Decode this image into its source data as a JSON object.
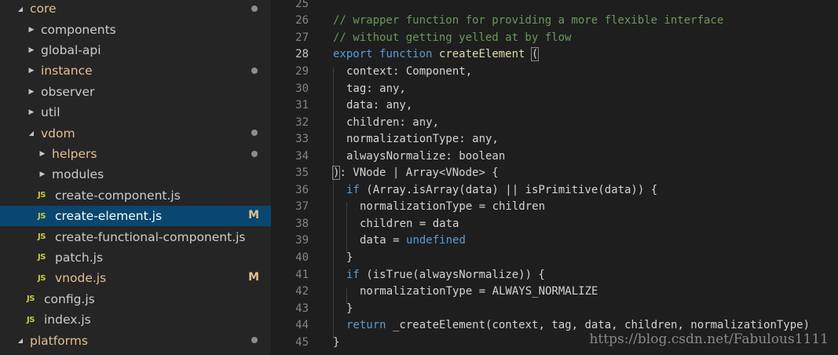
{
  "sidebar": {
    "items": [
      {
        "label": "core",
        "indent": 0,
        "kind": "folder-open",
        "modified": true,
        "marker": "dot",
        "selected": false
      },
      {
        "label": "components",
        "indent": 1,
        "kind": "folder",
        "modified": false,
        "marker": "",
        "selected": false
      },
      {
        "label": "global-api",
        "indent": 1,
        "kind": "folder",
        "modified": false,
        "marker": "",
        "selected": false
      },
      {
        "label": "instance",
        "indent": 1,
        "kind": "folder",
        "modified": true,
        "marker": "dot",
        "selected": false
      },
      {
        "label": "observer",
        "indent": 1,
        "kind": "folder",
        "modified": false,
        "marker": "",
        "selected": false
      },
      {
        "label": "util",
        "indent": 1,
        "kind": "folder",
        "modified": false,
        "marker": "",
        "selected": false
      },
      {
        "label": "vdom",
        "indent": 1,
        "kind": "folder-open",
        "modified": true,
        "marker": "dot",
        "selected": false
      },
      {
        "label": "helpers",
        "indent": 2,
        "kind": "folder",
        "modified": true,
        "marker": "dot",
        "selected": false
      },
      {
        "label": "modules",
        "indent": 2,
        "kind": "folder",
        "modified": false,
        "marker": "",
        "selected": false
      },
      {
        "label": "create-component.js",
        "indent": 2,
        "kind": "js",
        "modified": false,
        "marker": "",
        "selected": false
      },
      {
        "label": "create-element.js",
        "indent": 2,
        "kind": "js",
        "modified": true,
        "marker": "M",
        "selected": true
      },
      {
        "label": "create-functional-component.js",
        "indent": 2,
        "kind": "js",
        "modified": false,
        "marker": "",
        "selected": false
      },
      {
        "label": "patch.js",
        "indent": 2,
        "kind": "js",
        "modified": false,
        "marker": "",
        "selected": false
      },
      {
        "label": "vnode.js",
        "indent": 2,
        "kind": "js",
        "modified": true,
        "marker": "M",
        "selected": false
      },
      {
        "label": "config.js",
        "indent": 1,
        "kind": "js",
        "modified": false,
        "marker": "",
        "selected": false
      },
      {
        "label": "index.js",
        "indent": 1,
        "kind": "js",
        "modified": false,
        "marker": "",
        "selected": false
      },
      {
        "label": "platforms",
        "indent": 0,
        "kind": "folder-open",
        "modified": true,
        "marker": "dot",
        "selected": false
      }
    ],
    "js_icon_text": "JS"
  },
  "editor": {
    "active_line": "28",
    "lines": [
      {
        "n": "25",
        "indent": 0,
        "tokens": []
      },
      {
        "n": "26",
        "indent": 0,
        "tokens": [
          {
            "t": "// wrapper function for providing a more flexible interface",
            "c": "comment"
          }
        ]
      },
      {
        "n": "27",
        "indent": 0,
        "tokens": [
          {
            "t": "// without getting yelled at by flow",
            "c": "comment"
          }
        ]
      },
      {
        "n": "28",
        "indent": 0,
        "tokens": [
          {
            "t": "export",
            "c": "keyword"
          },
          {
            "t": " ",
            "c": "text"
          },
          {
            "t": "function",
            "c": "keyword"
          },
          {
            "t": " ",
            "c": "text"
          },
          {
            "t": "createElement",
            "c": "func"
          },
          {
            "t": " ",
            "c": "text"
          },
          {
            "t": "(",
            "c": "text",
            "box": true
          }
        ]
      },
      {
        "n": "29",
        "indent": 1,
        "tokens": [
          {
            "t": "context: Component,",
            "c": "text"
          }
        ]
      },
      {
        "n": "30",
        "indent": 1,
        "tokens": [
          {
            "t": "tag: any,",
            "c": "text"
          }
        ]
      },
      {
        "n": "31",
        "indent": 1,
        "tokens": [
          {
            "t": "data: any,",
            "c": "text"
          }
        ]
      },
      {
        "n": "32",
        "indent": 1,
        "tokens": [
          {
            "t": "children: any,",
            "c": "text"
          }
        ]
      },
      {
        "n": "33",
        "indent": 1,
        "tokens": [
          {
            "t": "normalizationType: any,",
            "c": "text"
          }
        ]
      },
      {
        "n": "34",
        "indent": 1,
        "tokens": [
          {
            "t": "alwaysNormalize: boolean",
            "c": "text"
          }
        ]
      },
      {
        "n": "35",
        "indent": 0,
        "tokens": [
          {
            "t": ")",
            "c": "text",
            "box": true
          },
          {
            "t": ": VNode | Array<VNode> {",
            "c": "text"
          }
        ]
      },
      {
        "n": "36",
        "indent": 1,
        "tokens": [
          {
            "t": "if",
            "c": "keyword"
          },
          {
            "t": " (Array.isArray(data) || isPrimitive(data)) {",
            "c": "text"
          }
        ]
      },
      {
        "n": "37",
        "indent": 2,
        "tokens": [
          {
            "t": "normalizationType = children",
            "c": "text"
          }
        ]
      },
      {
        "n": "38",
        "indent": 2,
        "tokens": [
          {
            "t": "children = data",
            "c": "text"
          }
        ]
      },
      {
        "n": "39",
        "indent": 2,
        "tokens": [
          {
            "t": "data = ",
            "c": "text"
          },
          {
            "t": "undefined",
            "c": "keyword"
          }
        ]
      },
      {
        "n": "40",
        "indent": 1,
        "tokens": [
          {
            "t": "}",
            "c": "text"
          }
        ]
      },
      {
        "n": "41",
        "indent": 1,
        "tokens": [
          {
            "t": "if",
            "c": "keyword"
          },
          {
            "t": " (isTrue(alwaysNormalize)) {",
            "c": "text"
          }
        ]
      },
      {
        "n": "42",
        "indent": 2,
        "tokens": [
          {
            "t": "normalizationType = ALWAYS_NORMALIZE",
            "c": "text"
          }
        ]
      },
      {
        "n": "43",
        "indent": 1,
        "tokens": [
          {
            "t": "}",
            "c": "text"
          }
        ]
      },
      {
        "n": "44",
        "indent": 1,
        "tokens": [
          {
            "t": "return",
            "c": "keyword"
          },
          {
            "t": " _createElement(context, tag, data, children, normalizationType)",
            "c": "text"
          }
        ]
      },
      {
        "n": "45",
        "indent": 0,
        "tokens": [
          {
            "t": "}",
            "c": "text"
          }
        ]
      }
    ]
  },
  "watermark": "https://blog.csdn.net/Fabulous1111",
  "colors": {
    "sidebar_bg": "#252526",
    "editor_bg": "#1e1e1e",
    "selection": "#094771",
    "modified": "#e2c08d",
    "comment": "#6a9955",
    "keyword": "#569cd6"
  }
}
